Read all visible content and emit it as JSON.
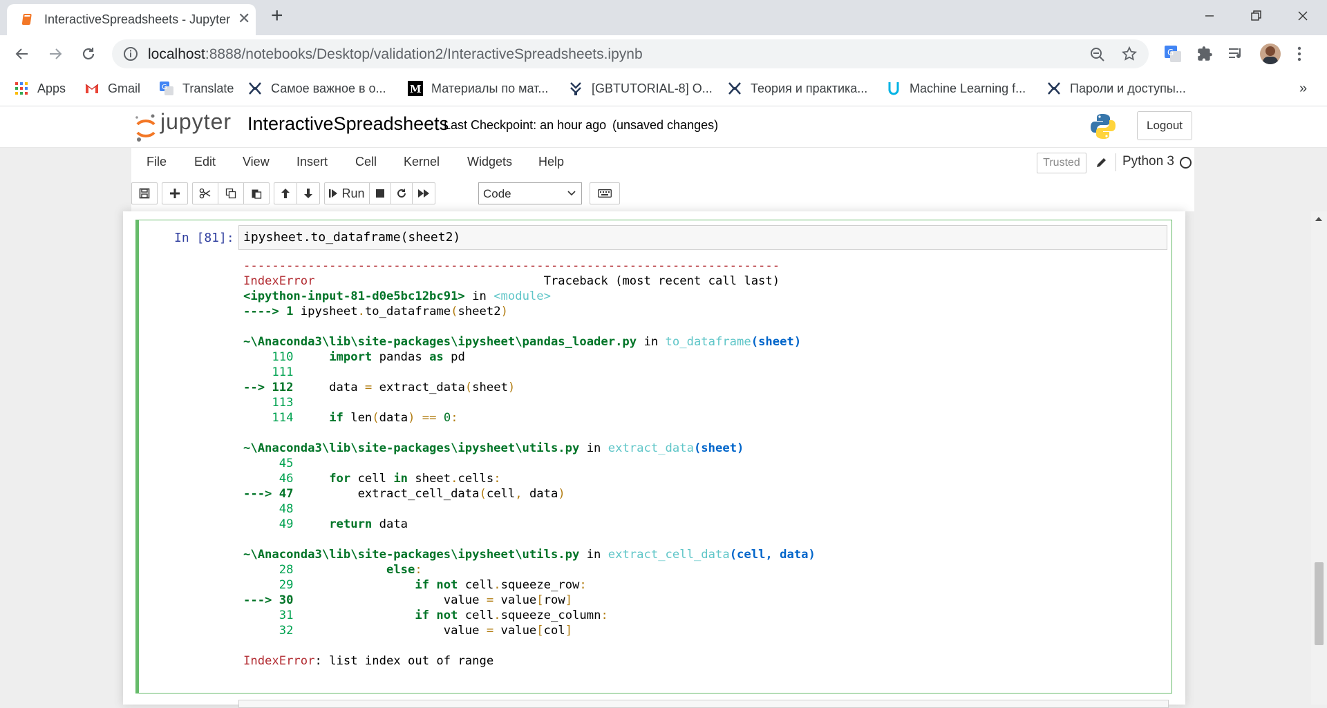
{
  "browser": {
    "tab_title": "InteractiveSpreadsheets - Jupyter Notebook",
    "url_host": "localhost",
    "url_path": ":8888/notebooks/Desktop/validation2/InteractiveSpreadsheets.ipynb",
    "bookmarks": [
      {
        "label": "Apps",
        "icon": "apps-grid-icon"
      },
      {
        "label": "Gmail",
        "icon": "gmail-icon"
      },
      {
        "label": "Translate",
        "icon": "google-translate-icon"
      },
      {
        "label": "Самое важное в о...",
        "icon": "bookmark-site-icon"
      },
      {
        "label": "Материалы по мат...",
        "icon": "medium-icon"
      },
      {
        "label": "[GBTUTORIAL-8] О...",
        "icon": "jira-icon"
      },
      {
        "label": "Теория и практика...",
        "icon": "bookmark-site-icon"
      },
      {
        "label": "Machine Learning f...",
        "icon": "udacity-icon"
      },
      {
        "label": "Пароли и доступы...",
        "icon": "bookmark-site-icon"
      }
    ],
    "bookmarks_overflow": "»"
  },
  "jupyter": {
    "logo_text": "jupyter",
    "notebook_name": "InteractiveSpreadsheets",
    "checkpoint": "Last Checkpoint: an hour ago",
    "unsaved": "(unsaved changes)",
    "logout": "Logout",
    "menu": [
      "File",
      "Edit",
      "View",
      "Insert",
      "Cell",
      "Kernel",
      "Widgets",
      "Help"
    ],
    "trusted": "Trusted",
    "kernel": "Python 3",
    "run_label": "Run",
    "cell_type": "Code"
  },
  "cell": {
    "prompt": "In [81]:",
    "code": "ipysheet.to_dataframe(sheet2)"
  }
}
